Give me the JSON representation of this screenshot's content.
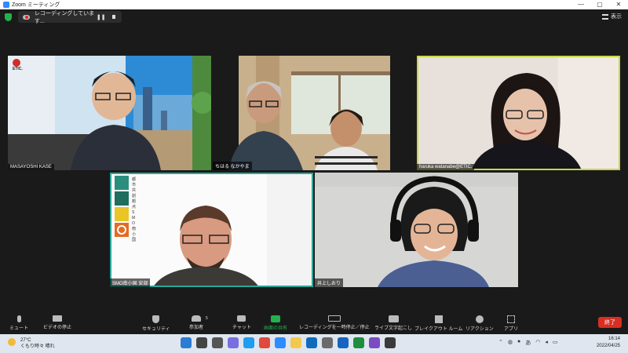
{
  "window": {
    "title": "Zoom ミーティング"
  },
  "recording": {
    "label": "レコーディングしています..."
  },
  "view_button": {
    "label": "表示"
  },
  "participants": [
    {
      "name": "MASAYOSHI KASE"
    },
    {
      "name": "ちはる なかやま"
    },
    {
      "name": "haruka watanabe@ETIC."
    },
    {
      "name": "SMO南小国 安部"
    },
    {
      "name": "井上しおり"
    }
  ],
  "tile_text": {
    "etic_logo": "ETIC.",
    "smo_sign": "都市共創拠点SMO南小国"
  },
  "toolbar": {
    "mute": "ミュート",
    "video": "ビデオの停止",
    "security": "セキュリティ",
    "participants": "参加者",
    "participants_count": "5",
    "chat": "チャット",
    "share": "画面の共有",
    "pause_recording": "レコーディングを一時停止／停止",
    "captions": "ライブ文字起こし",
    "breakout": "ブレイクアウト ルーム",
    "reactions": "リアクション",
    "apps": "アプリ",
    "end": "終了"
  },
  "taskbar": {
    "temperature": "27°C",
    "weather": "くもり時々 晴れ",
    "time": "16:14",
    "date": "2022/04/25",
    "ime": "あ"
  },
  "colors": {
    "accent_green": "#23b14d",
    "end_red": "#d92e23",
    "highlight_yellow": "#c9d64a",
    "highlight_teal": "#2aa79a"
  }
}
